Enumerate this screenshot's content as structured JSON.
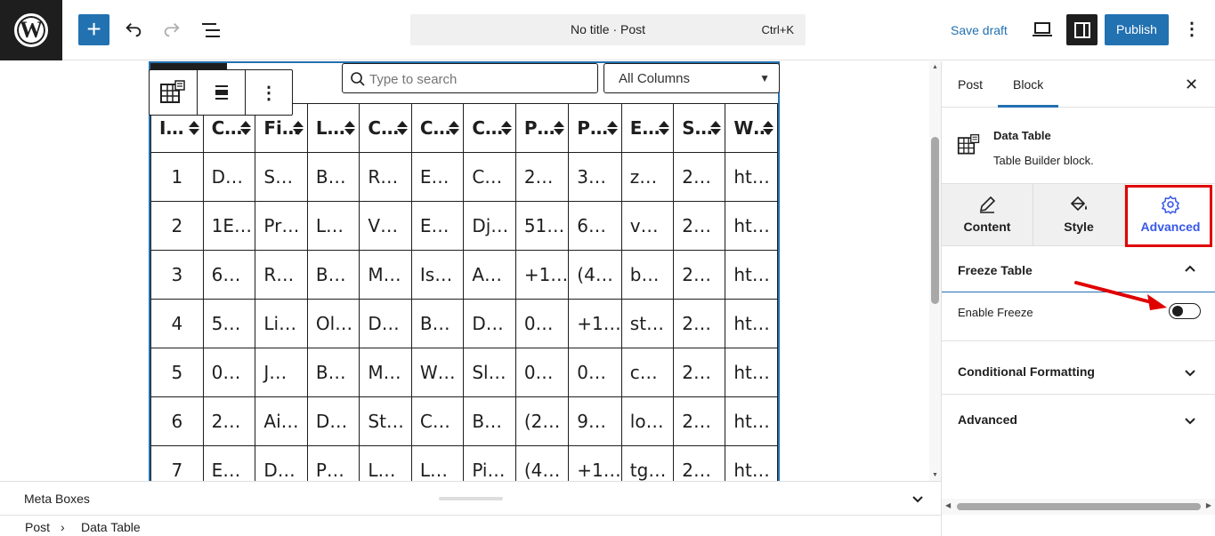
{
  "topbar": {
    "logo_letter": "W",
    "add_label": "+",
    "command_title": "No title · Post",
    "command_shortcut": "Ctrl+K",
    "save_draft": "Save draft",
    "publish": "Publish",
    "more": "⋮"
  },
  "table": {
    "search_placeholder": "Type to search",
    "column_filter": "All Columns",
    "headers": [
      "I…",
      "C…",
      "Fi…",
      "L…",
      "C…",
      "C…",
      "C…",
      "P…",
      "P…",
      "E…",
      "S…",
      "W…"
    ],
    "rows": [
      [
        "1",
        "D…",
        "S…",
        "B…",
        "R…",
        "E…",
        "C…",
        "2…",
        "3…",
        "z…",
        "2…",
        "ht…"
      ],
      [
        "2",
        "1E…",
        "Pr…",
        "L…",
        "V…",
        "E…",
        "Dj…",
        "51…",
        "6…",
        "v…",
        "2…",
        "ht…"
      ],
      [
        "3",
        "6…",
        "R…",
        "B…",
        "M…",
        "Is…",
        "A…",
        "+1…",
        "(4…",
        "b…",
        "2…",
        "ht…"
      ],
      [
        "4",
        "5…",
        "Li…",
        "Ol…",
        "D…",
        "B…",
        "D…",
        "0…",
        "+1…",
        "st…",
        "2…",
        "ht…"
      ],
      [
        "5",
        "0…",
        "J…",
        "B…",
        "M…",
        "W…",
        "Sl…",
        "0…",
        "0…",
        "c…",
        "2…",
        "ht…"
      ],
      [
        "6",
        "2…",
        "Ai…",
        "D…",
        "St…",
        "C…",
        "B…",
        "(2…",
        "9…",
        "lo…",
        "2…",
        "ht…"
      ],
      [
        "7",
        "E…",
        "D…",
        "P…",
        "L…",
        "L…",
        "Pi…",
        "(4…",
        "+1…",
        "tg…",
        "2…",
        "ht…"
      ]
    ]
  },
  "meta": {
    "label": "Meta Boxes"
  },
  "breadcrumb": {
    "items": [
      "Post",
      "Data Table"
    ],
    "separator": "›"
  },
  "sidebar": {
    "tab_post": "Post",
    "tab_block": "Block",
    "close": "✕",
    "block_title": "Data Table",
    "block_desc": "Table Builder block.",
    "tabs": [
      "Content",
      "Style",
      "Advanced"
    ],
    "freeze_title": "Freeze Table",
    "enable_freeze": "Enable Freeze",
    "enable_freeze_on": false,
    "conditional": "Conditional Formatting",
    "advanced": "Advanced"
  },
  "colors": {
    "accent": "#2271b1",
    "selected_tab": "#3858e9",
    "highlight": "#e00000"
  }
}
